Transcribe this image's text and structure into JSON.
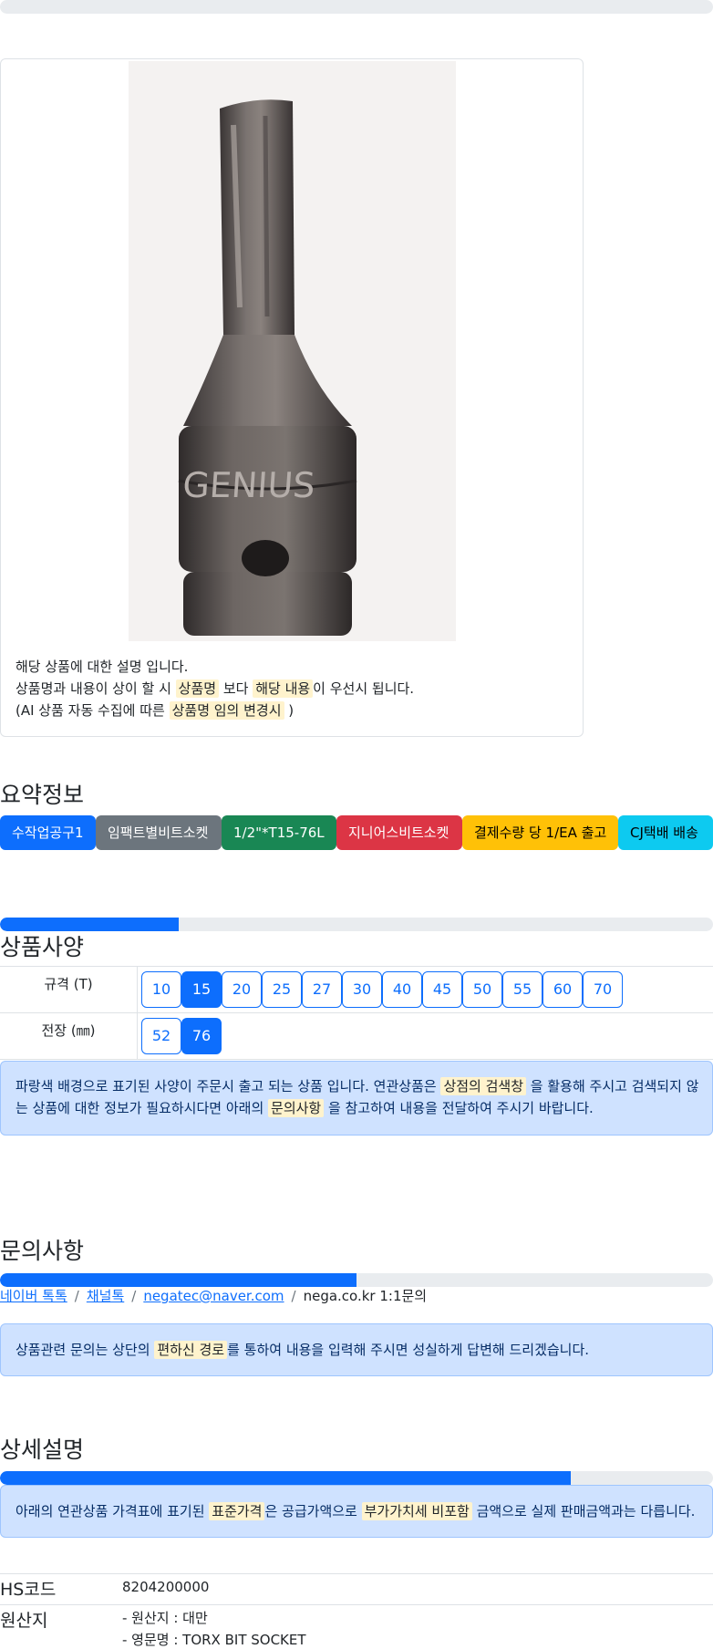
{
  "top_progress": {
    "value": 0
  },
  "product": {
    "image_alt": "GENIUS torx bit socket",
    "image_brand_text": "GENIUS",
    "desc_line1": "해당 상품에 대한 설명 입니다.",
    "desc_line2_a": "상품명과 내용이 상이 할 시 ",
    "desc_line2_mark1": "상품명",
    "desc_line2_b": " 보다 ",
    "desc_line2_mark2": "해당 내용",
    "desc_line2_c": "이 우선시 됩니다.",
    "desc_line3_a": "(AI 상품 자동 수집에 따른 ",
    "desc_line3_mark": "상품명 임의 변경시",
    "desc_line3_b": " )"
  },
  "summary": {
    "title": "요약정보",
    "badges": [
      "수작업공구1",
      "임팩트별비트소켓",
      "1/2\"*T15-76L",
      "지니어스비트소켓",
      "결제수량 당 1/EA 출고",
      "CJ택배 배송"
    ]
  },
  "spec": {
    "progress": 0.25,
    "title": "상품사양",
    "row1_label": "규격 (T)",
    "row1_options": [
      "10",
      "15",
      "20",
      "25",
      "27",
      "30",
      "40",
      "45",
      "50",
      "55",
      "60",
      "70"
    ],
    "row1_selected": "15",
    "row2_label": "전장 (㎜)",
    "row2_options": [
      "52",
      "76"
    ],
    "row2_selected": "76",
    "alert_a": "파랑색 배경으로 표기된 사양이 주문시 출고 되는 상품 입니다. 연관상품은 ",
    "alert_mark1": "상점의 검색창",
    "alert_b": " 을 활용해 주시고 검색되지 않",
    "alert_c": "는 상품에 대한 정보가 필요하시다면 아래의 ",
    "alert_mark2": "문의사항",
    "alert_d": " 을 참고하여 내용을 전달하여 주시기 바랍니다."
  },
  "inquiry": {
    "title": "문의사항",
    "progress": 0.5,
    "links": [
      "네이버 톡톡",
      "채널톡",
      "negatec@naver.com"
    ],
    "plain": "nega.co.kr 1:1문의",
    "separator": "/",
    "alert_a": "상품관련 문의는 상단의 ",
    "alert_mark": "편하신 경로",
    "alert_b": "를 통하여 내용을 입력해 주시면 성실하게 답변해 드리겠습니다."
  },
  "detail": {
    "title": "상세설명",
    "progress": 0.8,
    "alert_a": "아래의 연관상품 가격표에 표기된 ",
    "alert_mark1": "표준가격",
    "alert_b": "은 공급가액으로 ",
    "alert_mark2": "부가가치세 비포함",
    "alert_c": " 금액으로 실제 판매금액과는 다릅니다.",
    "hs_label": "HS코드",
    "hs_value": "8204200000",
    "origin_label": "원산지",
    "origin_line1": "- 원산지 : 대만",
    "origin_line2": "- 영문명 : TORX BIT SOCKET"
  }
}
